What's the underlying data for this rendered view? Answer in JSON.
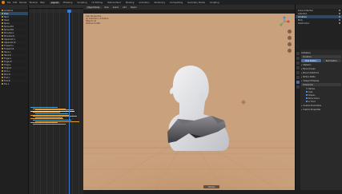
{
  "menubar": {
    "items": [
      "File",
      "Edit",
      "Render",
      "Window",
      "Help"
    ],
    "workspaces": [
      "Layout",
      "Modeling",
      "Sculpting",
      "UV Editing",
      "Texture Paint",
      "Shading",
      "Animation",
      "Rendering",
      "Compositing",
      "Geometry Nodes",
      "Scripting"
    ],
    "active_workspace": "Layout"
  },
  "outliner_left": {
    "rows": [
      "Armature",
      "Pose",
      "Neck",
      "Head",
      "Spine",
      "Spine.001",
      "Spine.002",
      "Shoulder.L",
      "Shoulder.R",
      "Upperarm.L",
      "Upperarm.R",
      "Forearm.L",
      "Forearm.R",
      "Hand.L",
      "Hand.R",
      "Finger.L",
      "Finger.R",
      "Thigh.L",
      "Thigh.R",
      "Shin.L",
      "Shin.R",
      "Foot.L",
      "Foot.R",
      "Toe.L"
    ],
    "selected_index": 1
  },
  "viewport": {
    "header_buttons": [
      "Object Mode",
      "View",
      "Select",
      "Add",
      "Object"
    ],
    "info_lines": [
      "User Perspective",
      "(1) Collection | Armature",
      "Objects  1/2",
      "Vertices  12,456"
    ],
    "bottom_label": "Camera"
  },
  "outliner_right": {
    "rows": [
      "Scene Collection",
      "Collection",
      "Armature",
      "Body",
      "Chest Armor"
    ],
    "selected_index": 2
  },
  "properties": {
    "object_name": "Armature",
    "field_name": "Armature",
    "pose_buttons": [
      "Pose Position",
      "Rest Position"
    ],
    "sections": [
      "Skeleton",
      "Bone Groups",
      "Bone Collections",
      "Motion Paths",
      "Viewport Display"
    ],
    "display_options": [
      {
        "label": "Names",
        "on": false
      },
      {
        "label": "Axes",
        "on": true
      },
      {
        "label": "Shapes",
        "on": true
      },
      {
        "label": "Bone Colors",
        "on": true
      },
      {
        "label": "In Front",
        "on": true
      }
    ],
    "display_as": "Octahedral",
    "bottom_sections": [
      "Inverse Kinematics",
      "Custom Properties"
    ]
  },
  "colors": {
    "viewport_bg": "#c9a17c",
    "selection": "#2d4a62",
    "keyframe": "#e79a2c",
    "accent_blue": "#3a7bd5"
  }
}
